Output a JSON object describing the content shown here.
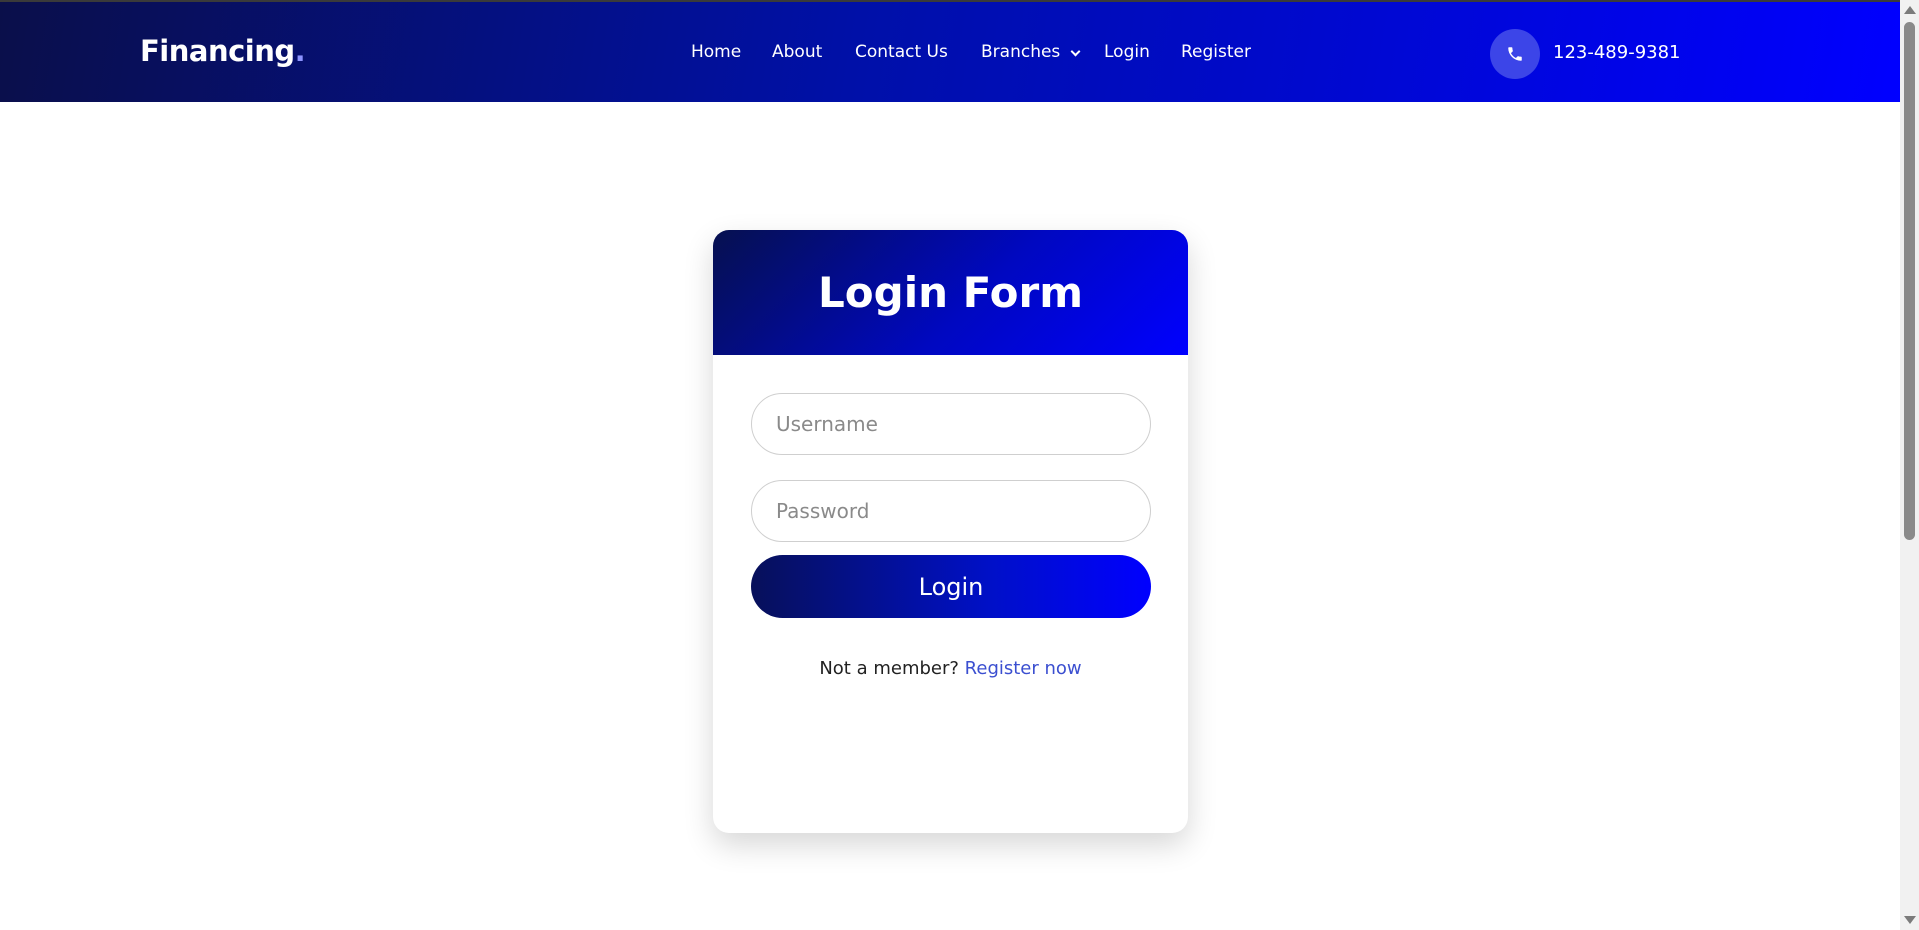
{
  "brand": {
    "name": "Financing",
    "dot": "."
  },
  "nav": {
    "items": [
      {
        "label": "Home"
      },
      {
        "label": "About"
      },
      {
        "label": "Contact Us"
      },
      {
        "label": "Branches"
      },
      {
        "label": "Login"
      },
      {
        "label": "Register"
      }
    ],
    "branches_dropdown_icon": "chevron-down-icon"
  },
  "contact": {
    "phone": "123-489-9381",
    "icon": "phone-icon"
  },
  "login_form": {
    "title": "Login Form",
    "username_placeholder": "Username",
    "password_placeholder": "Password",
    "submit_label": "Login",
    "signup_prompt": "Not a member?",
    "signup_link": "Register now"
  },
  "colors": {
    "nav_gradient_start": "#0a0f4a",
    "nav_gradient_end": "#0000ff",
    "link": "#3b4fd0",
    "phone_circle": "#3c45e8"
  }
}
